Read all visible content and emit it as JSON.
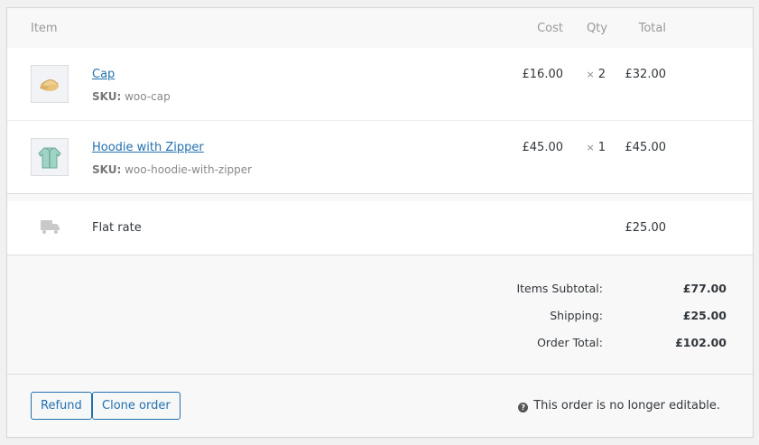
{
  "table": {
    "headers": {
      "item": "Item",
      "cost": "Cost",
      "qty": "Qty",
      "total": "Total"
    },
    "items": [
      {
        "name": "Cap",
        "sku_label": "SKU:",
        "sku": "woo-cap",
        "cost": "£16.00",
        "qty_prefix": "×",
        "qty": "2",
        "total": "£32.00",
        "thumb_icon": "cap-thumbnail"
      },
      {
        "name": "Hoodie with Zipper",
        "sku_label": "SKU:",
        "sku": "woo-hoodie-with-zipper",
        "cost": "£45.00",
        "qty_prefix": "×",
        "qty": "1",
        "total": "£45.00",
        "thumb_icon": "hoodie-thumbnail"
      }
    ],
    "shipping": {
      "icon": "truck-icon",
      "label": "Flat rate",
      "total": "£25.00"
    }
  },
  "totals": {
    "items_subtotal_label": "Items Subtotal:",
    "items_subtotal": "£77.00",
    "shipping_label": "Shipping:",
    "shipping": "£25.00",
    "order_total_label": "Order Total:",
    "order_total": "£102.00"
  },
  "footer": {
    "refund_label": "Refund",
    "clone_label": "Clone order",
    "help_icon": "?",
    "notice": "This order is no longer editable."
  },
  "colors": {
    "link": "#2271b1",
    "border": "#dcdcdc",
    "header_bg": "#f8f8f8"
  }
}
